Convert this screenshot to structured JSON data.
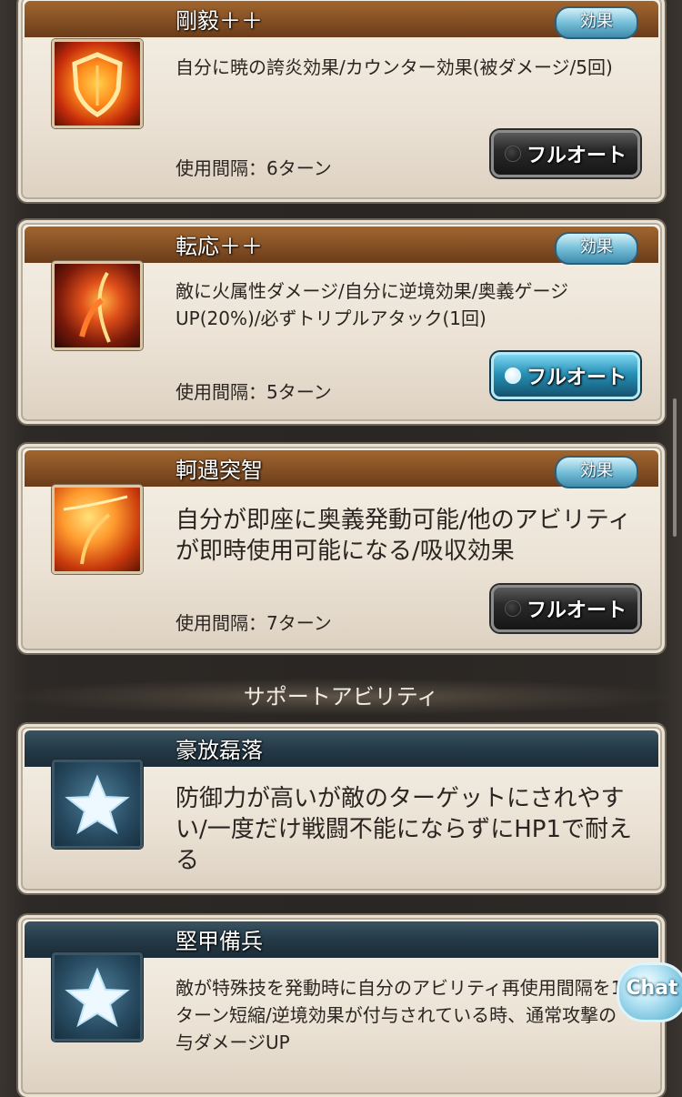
{
  "abilities": [
    {
      "name": "剛毅＋＋",
      "effect_label": "効果",
      "description": "自分に暁の誇炎効果/カウンター効果(被ダメージ/5回)",
      "interval": "使用間隔：6ターン",
      "auto_label": "フルオート",
      "auto_state": "off",
      "icon": "shield-flame-icon"
    },
    {
      "name": "転応＋＋",
      "effect_label": "効果",
      "description": "敵に火属性ダメージ/自分に逆境効果/奥義ゲージUP(20%)/必ずトリプルアタック(1回)",
      "interval": "使用間隔：5ターン",
      "auto_label": "フルオート",
      "auto_state": "on",
      "icon": "flame-slash-icon"
    },
    {
      "name": "軻遇突智",
      "effect_label": "効果",
      "description": "自分が即座に奥義発動可能/他のアビリティが即時使用可能になる/吸収効果",
      "interval": "使用間隔：7ターン",
      "auto_label": "フルオート",
      "auto_state": "off",
      "icon": "flame-burst-icon"
    }
  ],
  "section_title": "サポートアビリティ",
  "supports": [
    {
      "name": "豪放磊落",
      "description": "防御力が高いが敵のターゲットにされやすい/一度だけ戦闘不能にならずにHP1で耐える",
      "icon": "star-icon"
    },
    {
      "name": "堅甲備兵",
      "description": "敵が特殊技を発動時に自分のアビリティ再使用間隔を1ターン短縮/逆境効果が付与されている時、通常攻撃の与ダメージUP",
      "icon": "star-icon"
    }
  ],
  "chat_label": "Chat",
  "colors": {
    "ability_bar": "#8a5326",
    "support_bar": "#243a47",
    "effect_badge": "#76bfd8",
    "auto_on": "#2790b7"
  }
}
